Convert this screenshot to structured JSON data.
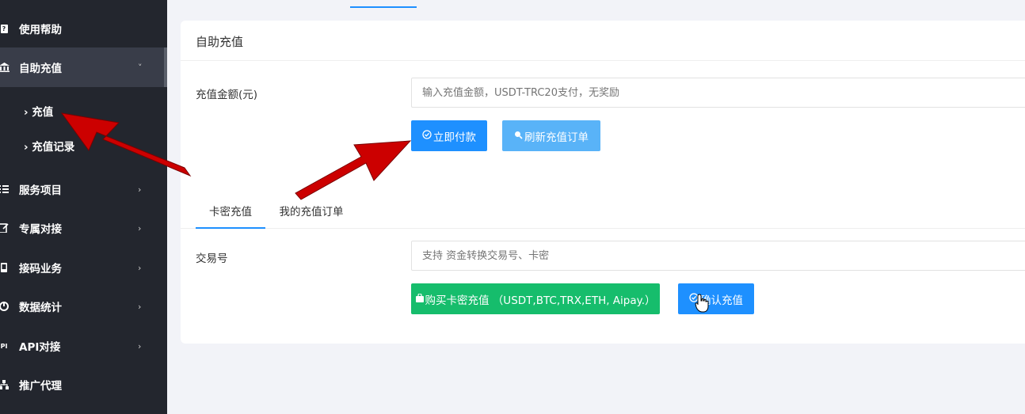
{
  "sidebar": {
    "items": [
      {
        "label": "使用帮助",
        "icon": "question-icon"
      },
      {
        "label": "自助充值",
        "icon": "bank-icon",
        "caret": "˅"
      },
      {
        "label": "服务项目",
        "icon": "list-icon",
        "caret": "›"
      },
      {
        "label": "专属对接",
        "icon": "edit-icon",
        "caret": "›"
      },
      {
        "label": "接码业务",
        "icon": "phone-icon",
        "caret": "›"
      },
      {
        "label": "数据统计",
        "icon": "chart-icon",
        "caret": "›"
      },
      {
        "label": "API对接",
        "icon": "api-icon",
        "caret": "›"
      },
      {
        "label": "推广代理",
        "icon": "sitemap-icon"
      }
    ],
    "sub_items": [
      {
        "label": "› 充值"
      },
      {
        "label": "› 充值记录"
      }
    ],
    "api_icon_text": "PI"
  },
  "card": {
    "title": "自助充值",
    "amount_label": "充值金额(元)",
    "amount_placeholder": "输入充值金额，USDT-TRC20支付，无奖励",
    "pay_button": "立即付款",
    "refresh_button": "刷新充值订单",
    "tabs": [
      {
        "label": "卡密充值",
        "active": true
      },
      {
        "label": "我的充值订单",
        "active": false
      }
    ],
    "txid_label": "交易号",
    "txid_placeholder": "支持 资金转换交易号、卡密",
    "buy_card_button": "购买卡密充值 （USDT,BTC,TRX,ETH, Aipay.）",
    "confirm_button": "确认充值"
  },
  "colors": {
    "sidebar_bg": "#23262e",
    "accent_blue": "#1e90ff",
    "light_blue": "#59b3f8",
    "green": "#16bd6c",
    "arrow_red": "#cc0000"
  }
}
